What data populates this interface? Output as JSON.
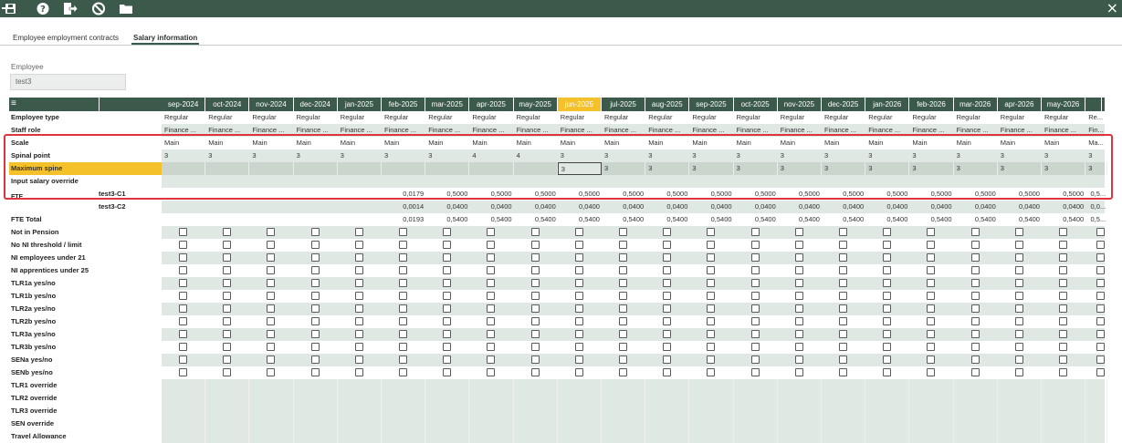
{
  "toolbar": {
    "icons": [
      "save-icon",
      "help-icon",
      "exit-icon",
      "cancel-icon",
      "folder-icon",
      "close-icon"
    ],
    "close_symbol": "×"
  },
  "tabs": [
    {
      "label": "Employee employment contracts",
      "active": false
    },
    {
      "label": "Salary information",
      "active": true
    }
  ],
  "employee": {
    "label": "Employee",
    "value": "test3"
  },
  "grid": {
    "menu_symbol": "≡",
    "months": [
      "sep-2024",
      "oct-2024",
      "nov-2024",
      "dec-2024",
      "jan-2025",
      "feb-2025",
      "mar-2025",
      "apr-2025",
      "may-2025",
      "jun-2025",
      "jul-2025",
      "aug-2025",
      "sep-2025",
      "oct-2025",
      "nov-2025",
      "dec-2025",
      "jan-2026",
      "feb-2026",
      "mar-2026",
      "apr-2026",
      "may-2026",
      ""
    ],
    "highlight_month": "jun-2025",
    "rows": [
      {
        "label": "Employee type",
        "values": [
          "Regular",
          "Regular",
          "Regular",
          "Regular",
          "Regular",
          "Regular",
          "Regular",
          "Regular",
          "Regular",
          "Regular",
          "Regular",
          "Regular",
          "Regular",
          "Regular",
          "Regular",
          "Regular",
          "Regular",
          "Regular",
          "Regular",
          "Regular",
          "Regular",
          "Re..."
        ]
      },
      {
        "label": "Staff role",
        "values": [
          "Finance ...",
          "Finance ...",
          "Finance ...",
          "Finance ...",
          "Finance ...",
          "Finance ...",
          "Finance ...",
          "Finance ...",
          "Finance ...",
          "Finance ...",
          "Finance ...",
          "Finance ...",
          "Finance ...",
          "Finance ...",
          "Finance ...",
          "Finance ...",
          "Finance ...",
          "Finance ...",
          "Finance ...",
          "Finance ...",
          "Finance ...",
          "Fin..."
        ]
      },
      {
        "label": "Scale",
        "values": [
          "Main",
          "Main",
          "Main",
          "Main",
          "Main",
          "Main",
          "Main",
          "Main",
          "Main",
          "Main",
          "Main",
          "Main",
          "Main",
          "Main",
          "Main",
          "Main",
          "Main",
          "Main",
          "Main",
          "Main",
          "Main",
          "Ma..."
        ]
      },
      {
        "label": "Spinal point",
        "values": [
          "3",
          "3",
          "3",
          "3",
          "3",
          "3",
          "3",
          "4",
          "4",
          "3",
          "3",
          "3",
          "3",
          "3",
          "3",
          "3",
          "3",
          "3",
          "3",
          "3",
          "3",
          "3"
        ]
      },
      {
        "label": "Maximum spine",
        "values": [
          "",
          "",
          "",
          "",
          "",
          "",
          "",
          "",
          "",
          "3",
          "3",
          "3",
          "3",
          "3",
          "3",
          "3",
          "3",
          "3",
          "3",
          "3",
          "3",
          "3"
        ]
      },
      {
        "label": "Input salary override",
        "values": [
          "",
          "",
          "",
          "",
          "",
          "",
          "",
          "",
          "",
          "",
          "",
          "",
          "",
          "",
          "",
          "",
          "",
          "",
          "",
          "",
          "",
          ""
        ]
      },
      {
        "label": "test3-C1",
        "values": [
          "",
          "",
          "",
          "",
          "",
          "0,0179",
          "0,5000",
          "0,5000",
          "0,5000",
          "0,5000",
          "0,5000",
          "0,5000",
          "0,5000",
          "0,5000",
          "0,5000",
          "0,5000",
          "0,5000",
          "0,5000",
          "0,5000",
          "0,5000",
          "0,5000",
          "0,5..."
        ]
      },
      {
        "label": "test3-C2",
        "values": [
          "",
          "",
          "",
          "",
          "",
          "0,0014",
          "0,0400",
          "0,0400",
          "0,0400",
          "0,0400",
          "0,0400",
          "0,0400",
          "0,0400",
          "0,0400",
          "0,0400",
          "0,0400",
          "0,0400",
          "0,0400",
          "0,0400",
          "0,0400",
          "0,0400",
          "0,0..."
        ]
      },
      {
        "label": "FTE Total",
        "values": [
          "",
          "",
          "",
          "",
          "",
          "0,0193",
          "0,5400",
          "0,5400",
          "0,5400",
          "0,5400",
          "0,5400",
          "0,5400",
          "0,5400",
          "0,5400",
          "0,5400",
          "0,5400",
          "0,5400",
          "0,5400",
          "0,5400",
          "0,5400",
          "0,5400",
          "0,5..."
        ]
      }
    ],
    "fte_label": "FTE",
    "checkbox_rows": [
      "Not in Pension",
      "No NI threshold / limit",
      "NI employees under 21",
      "NI apprentices under 25",
      "TLR1a yes/no",
      "TLR1b yes/no",
      "TLR2a yes/no",
      "TLR2b yes/no",
      "TLR3a yes/no",
      "TLR3b yes/no",
      "SENa yes/no",
      "SENb yes/no"
    ],
    "override_rows": [
      "TLR1 override",
      "TLR2 override",
      "TLR3 override",
      "SEN override",
      "Travel Allowance"
    ]
  },
  "colors": {
    "header_bg": "#3c5a4c",
    "highlight": "#f4c12a",
    "row_shade": "#dfe8e2",
    "red_outline": "#e0343d"
  }
}
